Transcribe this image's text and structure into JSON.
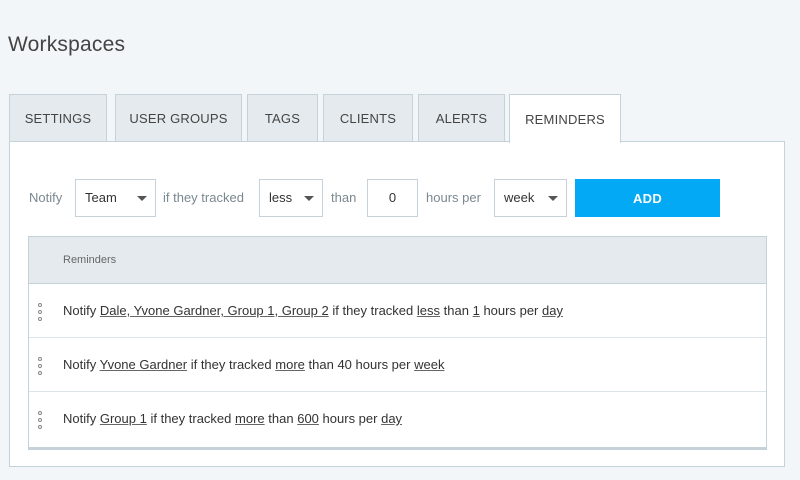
{
  "page_title": "Workspaces",
  "tabs": [
    {
      "label": "SETTINGS"
    },
    {
      "label": "USER GROUPS"
    },
    {
      "label": "TAGS"
    },
    {
      "label": "CLIENTS"
    },
    {
      "label": "ALERTS"
    },
    {
      "label": "REMINDERS",
      "active": true
    }
  ],
  "form": {
    "notify_label": "Notify",
    "who_value": "Team",
    "tracked_label": "if they tracked",
    "comparison_value": "less",
    "than_label": "than",
    "hours_value": "0",
    "hours_per_label": "hours per",
    "period_value": "week",
    "add_label": "ADD"
  },
  "table": {
    "header": "Reminders",
    "rows": [
      {
        "notify": "Notify",
        "who": "Dale, Yvone Gardner, Group 1, Group 2",
        "tracked": "if they tracked",
        "comparison": "less",
        "than": "than",
        "hours": "1",
        "hours_per": "hours per",
        "period": "day"
      },
      {
        "notify": "Notify",
        "who": "Yvone Gardner",
        "tracked": "if they tracked",
        "comparison": "more",
        "than": "than",
        "hours": "40",
        "hours_per": "hours per",
        "period": "week"
      },
      {
        "notify": "Notify",
        "who": "Group 1",
        "tracked": "if they tracked",
        "comparison": "more",
        "than": "than",
        "hours": "600",
        "hours_per": "hours per",
        "period": "day"
      }
    ]
  },
  "icons": {
    "caret": "chevron-down-icon",
    "drag": "drag-handle-icon"
  },
  "colors": {
    "accent": "#03a9f4",
    "background": "#f2f6f8",
    "tab_inactive": "#e4eaee",
    "border": "#c6d2d9"
  }
}
